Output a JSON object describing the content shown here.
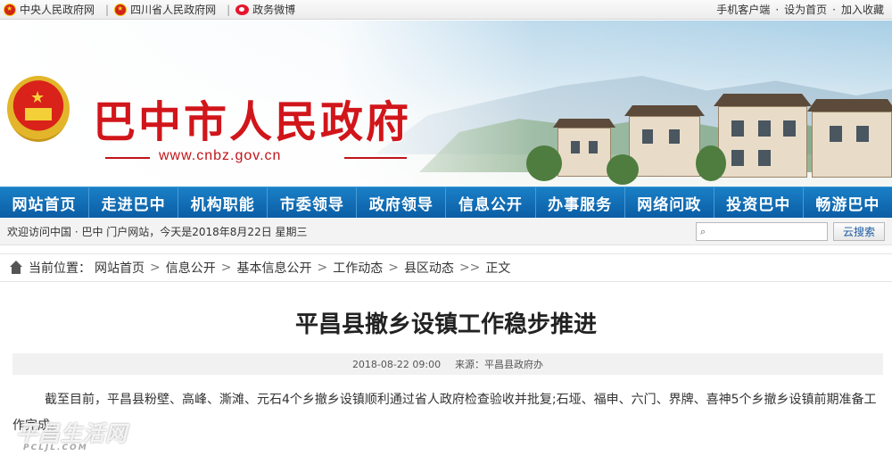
{
  "topbar": {
    "link1": "中央人民政府网",
    "link2": "四川省人民政府网",
    "link3": "政务微博",
    "right1": "手机客户端",
    "right2": "设为首页",
    "right3": "加入收藏"
  },
  "banner": {
    "title": "巴中市人民政府",
    "url": "www.cnbz.gov.cn"
  },
  "nav": [
    "网站首页",
    "走进巴中",
    "机构职能",
    "市委领导",
    "政府领导",
    "信息公开",
    "办事服务",
    "网络问政",
    "投资巴中",
    "畅游巴中"
  ],
  "welcome": {
    "text": "欢迎访问中国 · 巴中 门户网站，今天是2018年8月22日 星期三",
    "search_value": "",
    "search_button": "云搜索"
  },
  "breadcrumb": {
    "label": "当前位置：",
    "items": [
      "网站首页",
      "信息公开",
      "基本信息公开",
      "工作动态",
      "县区动态",
      "正文"
    ],
    "sep1": ">",
    "sep_last": ">>"
  },
  "article": {
    "title": "平昌县撤乡设镇工作稳步推进",
    "datetime": "2018-08-22 09:00",
    "source": "来源：平昌县政府办",
    "body": "截至目前，平昌县粉壁、高峰、澌滩、元石4个乡撤乡设镇顺利通过省人政府检查验收并批复;石垭、福申、六门、界牌、喜神5个乡撤乡设镇前期准备工作完成。"
  },
  "watermark": {
    "main": "平昌生活网",
    "sub": "PCLJL.COM"
  }
}
